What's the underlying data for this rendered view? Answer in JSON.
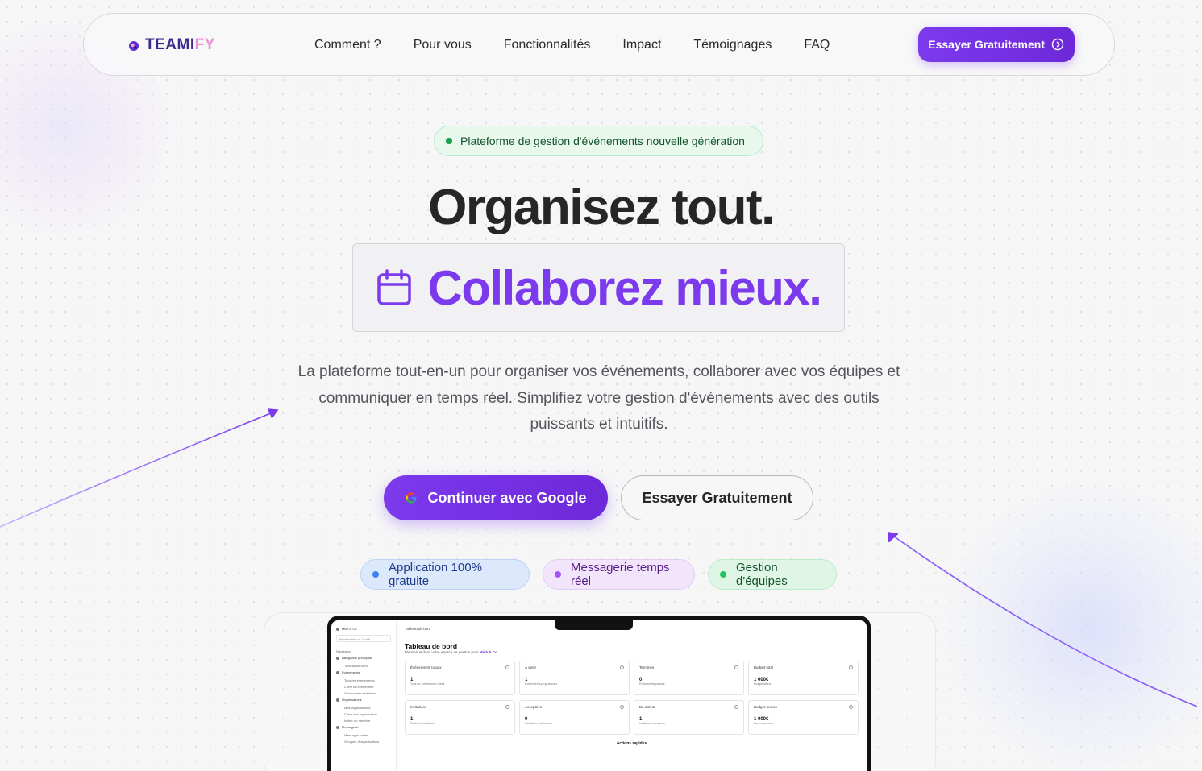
{
  "brand": {
    "logo_part1": "TEAMI",
    "logo_part2": "FY",
    "primary_color": "#7c3aed",
    "accent_pink": "#e991d9"
  },
  "nav": {
    "links": [
      "Comment ?",
      "Pour vous",
      "Fonctionnalités",
      "Impact",
      "Témoignages",
      "FAQ"
    ],
    "cta_label": "Essayer Gratuitement",
    "cta_icon": "arrow-circle-right-icon"
  },
  "hero": {
    "badge": "Plateforme de gestion d'événements nouvelle génération",
    "title": "Organisez tout.",
    "subtitle": "Collaborez mieux.",
    "subtitle_icon": "calendar-icon",
    "lead": "La plateforme tout-en-un pour organiser vos événements, collaborer avec vos équipes et communiquer en temps réel. Simplifiez votre gestion d'événements avec des outils puissants et intuitifs.",
    "google_button": "Continuer avec Google",
    "google_icon": "google-icon",
    "try_button": "Essayer Gratuitement"
  },
  "pills": [
    {
      "label": "Application 100% gratuite",
      "color": "#3b82f6"
    },
    {
      "label": "Messagerie temps réel",
      "color": "#a855f7"
    },
    {
      "label": "Gestion d'équipes",
      "color": "#22c55e"
    }
  ],
  "preview": {
    "org_name": "Mich & Co",
    "search_placeholder": "Rechercher ou Ctrl+K",
    "nav_heading": "Navigation",
    "sidebar": [
      {
        "label": "Navigation principale",
        "items": [
          "Tableau de bord"
        ]
      },
      {
        "label": "Événements",
        "items": [
          "Tous les événements",
          "Créer un événement",
          "Gestion des invitations"
        ]
      },
      {
        "label": "Organisations",
        "items": [
          "Mes organisations",
          "Créer une organisation",
          "Inviter un membre"
        ]
      },
      {
        "label": "Messagerie",
        "items": [
          "Messages privés",
          "Groupes d'organisations"
        ]
      }
    ],
    "breadcrumb": "Tableau de bord",
    "title": "Tableau de bord",
    "welcome_prefix": "Bienvenue dans votre espace de gestion pour ",
    "welcome_org": "Mich & Co",
    "cards": [
      {
        "title": "Événements totaux",
        "value": "1",
        "sub": "Tous les événements créés"
      },
      {
        "title": "À venir",
        "value": "1",
        "sub": "Événements programmés"
      },
      {
        "title": "Terminés",
        "value": "0",
        "sub": "Événements passés"
      },
      {
        "title": "Budget total",
        "value": "1 000€",
        "sub": "Budget alloué"
      },
      {
        "title": "Invitations",
        "value": "1",
        "sub": "Total des invitations"
      },
      {
        "title": "Acceptées",
        "value": "0",
        "sub": "Invitations confirmées"
      },
      {
        "title": "En attente",
        "value": "1",
        "sub": "Invitations en attente"
      },
      {
        "title": "Budget moyen",
        "value": "1 000€",
        "sub": "Par événement"
      }
    ],
    "actions_title": "Actions rapides"
  }
}
